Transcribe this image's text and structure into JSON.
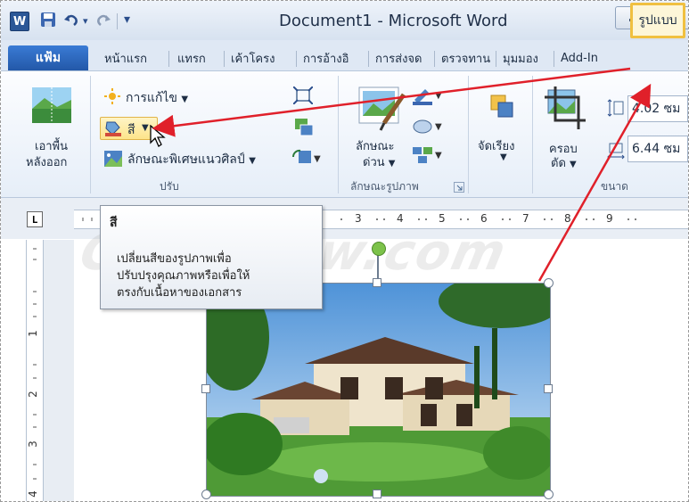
{
  "title_bar": {
    "app_icon_letter": "W",
    "document_title": "Document1 - Microsoft Word"
  },
  "tabs": {
    "file": "แฟ้ม",
    "items": [
      "หน้าแรก",
      "แทรก",
      "เค้าโครง",
      "การอ้างอิ",
      "การส่งจด",
      "ตรวจทาน",
      "มุมมอง",
      "Add-In"
    ],
    "active": "รูปแบบ"
  },
  "ribbon": {
    "remove_background": [
      "เอาพื้น",
      "หลังออก"
    ],
    "corrections": "การแก้ไข",
    "color": "สี",
    "artistic_effects": "ลักษณะพิเศษแนวศิลป์",
    "quick_styles": [
      "ลักษณะ",
      "ด่วน"
    ],
    "arrange": "จัดเรียง",
    "crop": [
      "ครอบ",
      "ตัด"
    ],
    "height": "4.02 ซม",
    "width": "6.44 ซม",
    "groups": {
      "adjust": "ปรับ",
      "picture_styles": "ลักษณะรูปภาพ",
      "size": "ขนาด"
    }
  },
  "ruler": {
    "numbers": [
      "3",
      "4",
      "5",
      "6",
      "7",
      "8",
      "9"
    ],
    "vertical_numbers": [
      "1",
      "2",
      "3",
      "4"
    ],
    "corner": "L"
  },
  "tooltip": {
    "title": "สี",
    "lines": [
      "เปลี่ยนสีของรูปภาพเพื่อ",
      "ปรับปรุงคุณภาพหรือเพื่อให้",
      "ตรงกับเนื้อหาของเอกสาร"
    ]
  },
  "watermark": "Com5dow.com",
  "colors": {
    "accent_highlight": "#f0c040",
    "arrow": "#e0202a",
    "file_tab": "#2a62b8"
  }
}
